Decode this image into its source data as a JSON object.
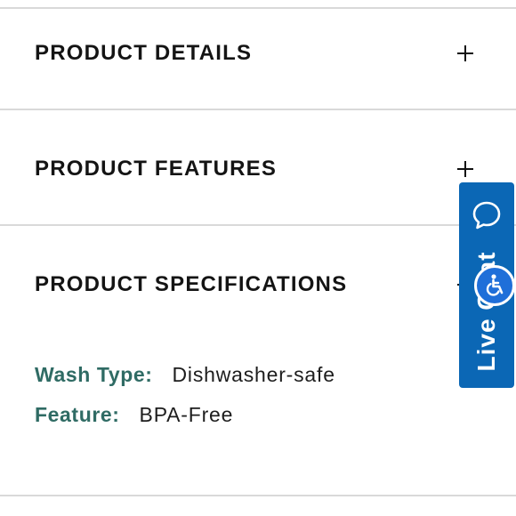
{
  "accordion": {
    "details": {
      "title": "PRODUCT DETAILS",
      "expanded": false
    },
    "features": {
      "title": "PRODUCT FEATURES",
      "expanded": false
    },
    "specifications": {
      "title": "PRODUCT SPECIFICATIONS",
      "expanded": true,
      "specs": [
        {
          "label": "Wash Type:",
          "value": "Dishwasher-safe"
        },
        {
          "label": "Feature:",
          "value": "BPA-Free"
        }
      ]
    }
  },
  "live_chat": {
    "label": "Live Chat",
    "icon": "chat-bubble-icon"
  },
  "accessibility": {
    "icon": "wheelchair-accessibility-icon"
  },
  "colors": {
    "spec_label": "#2f6b64",
    "live_chat_bg": "#0b67b5",
    "a11y_bg": "#1f6fd9",
    "divider": "#d9d9d9"
  }
}
